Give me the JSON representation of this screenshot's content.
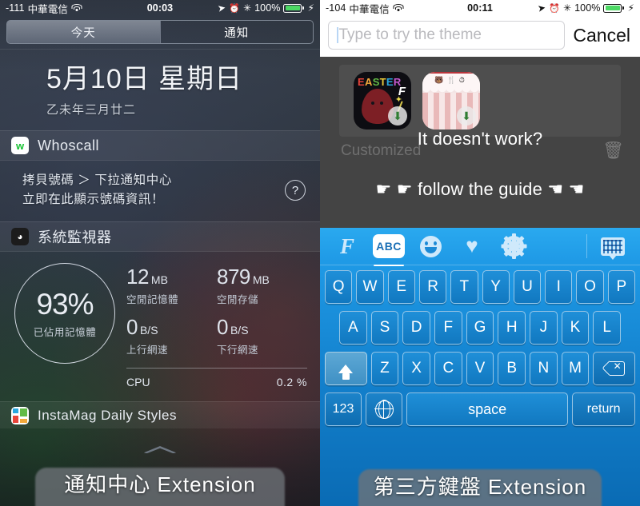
{
  "left": {
    "status_bar": {
      "signal": "-111",
      "carrier": "中華電信",
      "wifi_icon": "wifi-icon",
      "time": "00:03",
      "location_icon": "location-arrow-icon",
      "alarm_icon": "alarm-clock-icon",
      "bluetooth_icon": "bluetooth-icon",
      "battery_percent": "100%",
      "charging_icon": "lightning-bolt-icon"
    },
    "segmented_control": {
      "tabs": [
        {
          "label": "今天",
          "active": true
        },
        {
          "label": "通知",
          "active": false
        }
      ]
    },
    "date": {
      "main": "5月10日 星期日",
      "lunar": "乙未年三月廿二"
    },
    "widgets": [
      {
        "icon": "whoscall-app-icon",
        "icon_glyph": "w",
        "title": "Whoscall",
        "body_line1": "拷貝號碼 ＞ 下拉通知中心",
        "body_line2": "立即在此顯示號碼資訊！",
        "help_icon": "question-mark-icon",
        "help_label": "?"
      },
      {
        "icon": "system-monitor-app-icon",
        "icon_glyph": "◕",
        "title": "系統監視器",
        "gauge": {
          "value": "93%",
          "label": "已佔用記憶體"
        },
        "stats": [
          {
            "value": "12",
            "unit": "MB",
            "label": "空閒記憶體"
          },
          {
            "value": "879",
            "unit": "MB",
            "label": "空閒存儲"
          },
          {
            "value": "0",
            "unit": "B/S",
            "label": "上行網速"
          },
          {
            "value": "0",
            "unit": "B/S",
            "label": "下行網速"
          }
        ],
        "cpu_label": "CPU",
        "cpu_value": "0.2 %"
      },
      {
        "icon": "instamag-app-icon",
        "title": "InstaMag Daily Styles"
      }
    ],
    "grabber": "drag-handle",
    "caption": "通知中心 Extension"
  },
  "right": {
    "status_bar": {
      "signal": "-104",
      "carrier": "中華電信",
      "wifi_icon": "wifi-icon",
      "time": "00:11",
      "location_icon": "location-arrow-icon",
      "alarm_icon": "alarm-clock-icon",
      "bluetooth_icon": "bluetooth-icon",
      "battery_percent": "100%",
      "charging_icon": "lightning-bolt-icon"
    },
    "search": {
      "placeholder": "Type to try the theme",
      "value": "",
      "cancel_label": "Cancel"
    },
    "app": {
      "tiles": [
        {
          "name": "easter-theme-tile",
          "title": "EASTER",
          "download_icon": "download-icon"
        },
        {
          "name": "cake-theme-tile",
          "download_icon": "download-icon"
        }
      ],
      "customized_label": "Customized",
      "trash_icon": "trash-icon",
      "overlay_title": "It doesn't work?",
      "overlay_guide": "☛ ☛ follow the guide ☚ ☚"
    },
    "keyboard": {
      "toolbar": [
        {
          "name": "facemoji-logo-icon",
          "label": "F",
          "active": false
        },
        {
          "name": "abc-keyboard-icon",
          "label": "ABC",
          "active": true
        },
        {
          "name": "emoji-smiley-icon",
          "label": "",
          "active": false
        },
        {
          "name": "sticker-heart-icon",
          "label": "",
          "active": false
        },
        {
          "name": "settings-gear-icon",
          "label": "",
          "active": false
        },
        {
          "name": "keyboard-switch-icon",
          "label": "",
          "active": false
        }
      ],
      "rows": [
        [
          "Q",
          "W",
          "E",
          "R",
          "T",
          "Y",
          "U",
          "I",
          "O",
          "P"
        ],
        [
          "A",
          "S",
          "D",
          "F",
          "G",
          "H",
          "J",
          "K",
          "L"
        ],
        [
          "Z",
          "X",
          "C",
          "V",
          "B",
          "N",
          "M"
        ]
      ],
      "shift_icon": "shift-up-arrow-icon",
      "delete_icon": "backspace-delete-icon",
      "numeric_label": "123",
      "globe_icon": "globe-language-icon",
      "space_label": "space",
      "return_label": "return"
    },
    "caption": "第三方鍵盤 Extension"
  },
  "colors": {
    "keyboard_blue": "#1b8ad6",
    "battery_green": "#4cd964",
    "whoscall_green": "#17c132"
  }
}
